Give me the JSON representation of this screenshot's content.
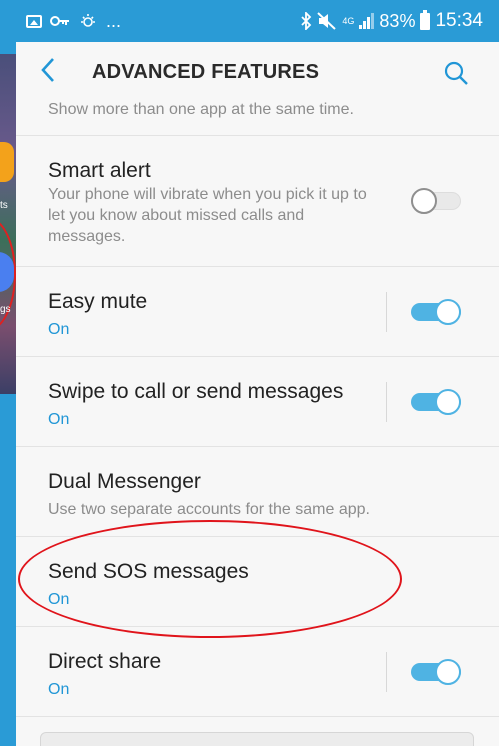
{
  "status_bar": {
    "left_more": "...",
    "network": "4G",
    "battery": "83%",
    "time": "15:34"
  },
  "background": {
    "label_1": "ts",
    "label_2": "gs"
  },
  "header": {
    "title": "ADVANCED FEATURES"
  },
  "partial_item": {
    "description": "Show more than one app at the same time."
  },
  "items": [
    {
      "title": "Smart alert",
      "description": "Your phone will vibrate when you pick it up to let you know about missed calls and messages.",
      "toggle": "off"
    },
    {
      "title": "Easy mute",
      "status": "On",
      "toggle": "on"
    },
    {
      "title": "Swipe to call or send messages",
      "status": "On",
      "toggle": "on"
    },
    {
      "title": "Dual Messenger",
      "description": "Use two separate accounts for the same app."
    },
    {
      "title": "Send SOS messages",
      "status": "On"
    },
    {
      "title": "Direct share",
      "status": "On",
      "toggle": "on"
    }
  ],
  "icons": [
    "image-icon",
    "key-icon",
    "sync-icon",
    "bluetooth-icon",
    "mute-icon",
    "signal-icon",
    "battery-icon",
    "back-arrow-icon",
    "search-icon"
  ],
  "colors": {
    "accent": "#2196d6",
    "toggle_on": "#4fb3e3",
    "annotation": "#e0141b",
    "outer_bg": "#2a9bd6"
  }
}
